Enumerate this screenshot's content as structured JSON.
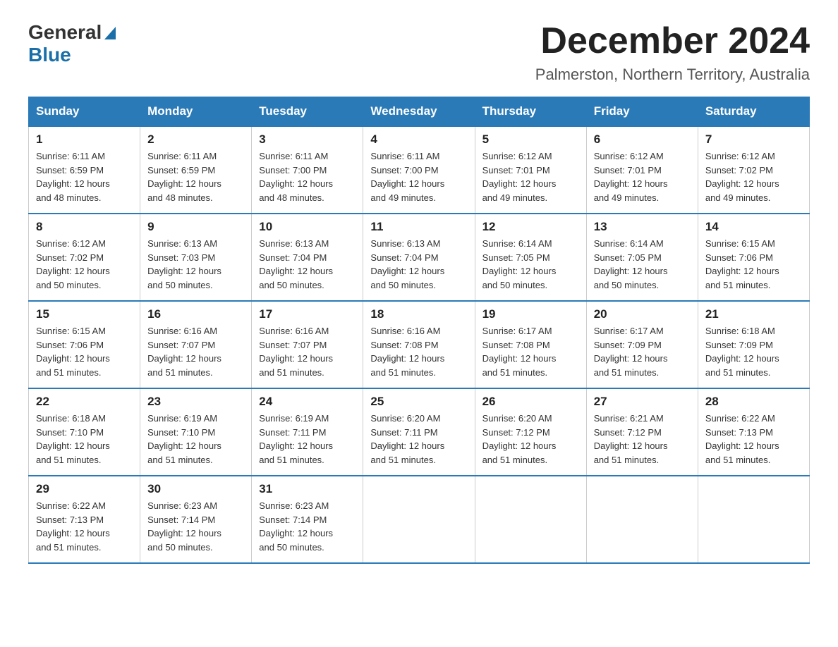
{
  "logo": {
    "general": "General",
    "blue": "Blue"
  },
  "title": "December 2024",
  "location": "Palmerston, Northern Territory, Australia",
  "headers": [
    "Sunday",
    "Monday",
    "Tuesday",
    "Wednesday",
    "Thursday",
    "Friday",
    "Saturday"
  ],
  "weeks": [
    [
      {
        "day": "1",
        "sunrise": "6:11 AM",
        "sunset": "6:59 PM",
        "daylight": "12 hours and 48 minutes."
      },
      {
        "day": "2",
        "sunrise": "6:11 AM",
        "sunset": "6:59 PM",
        "daylight": "12 hours and 48 minutes."
      },
      {
        "day": "3",
        "sunrise": "6:11 AM",
        "sunset": "7:00 PM",
        "daylight": "12 hours and 48 minutes."
      },
      {
        "day": "4",
        "sunrise": "6:11 AM",
        "sunset": "7:00 PM",
        "daylight": "12 hours and 49 minutes."
      },
      {
        "day": "5",
        "sunrise": "6:12 AM",
        "sunset": "7:01 PM",
        "daylight": "12 hours and 49 minutes."
      },
      {
        "day": "6",
        "sunrise": "6:12 AM",
        "sunset": "7:01 PM",
        "daylight": "12 hours and 49 minutes."
      },
      {
        "day": "7",
        "sunrise": "6:12 AM",
        "sunset": "7:02 PM",
        "daylight": "12 hours and 49 minutes."
      }
    ],
    [
      {
        "day": "8",
        "sunrise": "6:12 AM",
        "sunset": "7:02 PM",
        "daylight": "12 hours and 50 minutes."
      },
      {
        "day": "9",
        "sunrise": "6:13 AM",
        "sunset": "7:03 PM",
        "daylight": "12 hours and 50 minutes."
      },
      {
        "day": "10",
        "sunrise": "6:13 AM",
        "sunset": "7:04 PM",
        "daylight": "12 hours and 50 minutes."
      },
      {
        "day": "11",
        "sunrise": "6:13 AM",
        "sunset": "7:04 PM",
        "daylight": "12 hours and 50 minutes."
      },
      {
        "day": "12",
        "sunrise": "6:14 AM",
        "sunset": "7:05 PM",
        "daylight": "12 hours and 50 minutes."
      },
      {
        "day": "13",
        "sunrise": "6:14 AM",
        "sunset": "7:05 PM",
        "daylight": "12 hours and 50 minutes."
      },
      {
        "day": "14",
        "sunrise": "6:15 AM",
        "sunset": "7:06 PM",
        "daylight": "12 hours and 51 minutes."
      }
    ],
    [
      {
        "day": "15",
        "sunrise": "6:15 AM",
        "sunset": "7:06 PM",
        "daylight": "12 hours and 51 minutes."
      },
      {
        "day": "16",
        "sunrise": "6:16 AM",
        "sunset": "7:07 PM",
        "daylight": "12 hours and 51 minutes."
      },
      {
        "day": "17",
        "sunrise": "6:16 AM",
        "sunset": "7:07 PM",
        "daylight": "12 hours and 51 minutes."
      },
      {
        "day": "18",
        "sunrise": "6:16 AM",
        "sunset": "7:08 PM",
        "daylight": "12 hours and 51 minutes."
      },
      {
        "day": "19",
        "sunrise": "6:17 AM",
        "sunset": "7:08 PM",
        "daylight": "12 hours and 51 minutes."
      },
      {
        "day": "20",
        "sunrise": "6:17 AM",
        "sunset": "7:09 PM",
        "daylight": "12 hours and 51 minutes."
      },
      {
        "day": "21",
        "sunrise": "6:18 AM",
        "sunset": "7:09 PM",
        "daylight": "12 hours and 51 minutes."
      }
    ],
    [
      {
        "day": "22",
        "sunrise": "6:18 AM",
        "sunset": "7:10 PM",
        "daylight": "12 hours and 51 minutes."
      },
      {
        "day": "23",
        "sunrise": "6:19 AM",
        "sunset": "7:10 PM",
        "daylight": "12 hours and 51 minutes."
      },
      {
        "day": "24",
        "sunrise": "6:19 AM",
        "sunset": "7:11 PM",
        "daylight": "12 hours and 51 minutes."
      },
      {
        "day": "25",
        "sunrise": "6:20 AM",
        "sunset": "7:11 PM",
        "daylight": "12 hours and 51 minutes."
      },
      {
        "day": "26",
        "sunrise": "6:20 AM",
        "sunset": "7:12 PM",
        "daylight": "12 hours and 51 minutes."
      },
      {
        "day": "27",
        "sunrise": "6:21 AM",
        "sunset": "7:12 PM",
        "daylight": "12 hours and 51 minutes."
      },
      {
        "day": "28",
        "sunrise": "6:22 AM",
        "sunset": "7:13 PM",
        "daylight": "12 hours and 51 minutes."
      }
    ],
    [
      {
        "day": "29",
        "sunrise": "6:22 AM",
        "sunset": "7:13 PM",
        "daylight": "12 hours and 51 minutes."
      },
      {
        "day": "30",
        "sunrise": "6:23 AM",
        "sunset": "7:14 PM",
        "daylight": "12 hours and 50 minutes."
      },
      {
        "day": "31",
        "sunrise": "6:23 AM",
        "sunset": "7:14 PM",
        "daylight": "12 hours and 50 minutes."
      },
      null,
      null,
      null,
      null
    ]
  ],
  "labels": {
    "sunrise": "Sunrise:",
    "sunset": "Sunset:",
    "daylight": "Daylight:"
  },
  "colors": {
    "header_bg": "#2a7ab8",
    "header_text": "#ffffff",
    "border": "#cccccc",
    "text_dark": "#222222",
    "text_mid": "#333333"
  }
}
